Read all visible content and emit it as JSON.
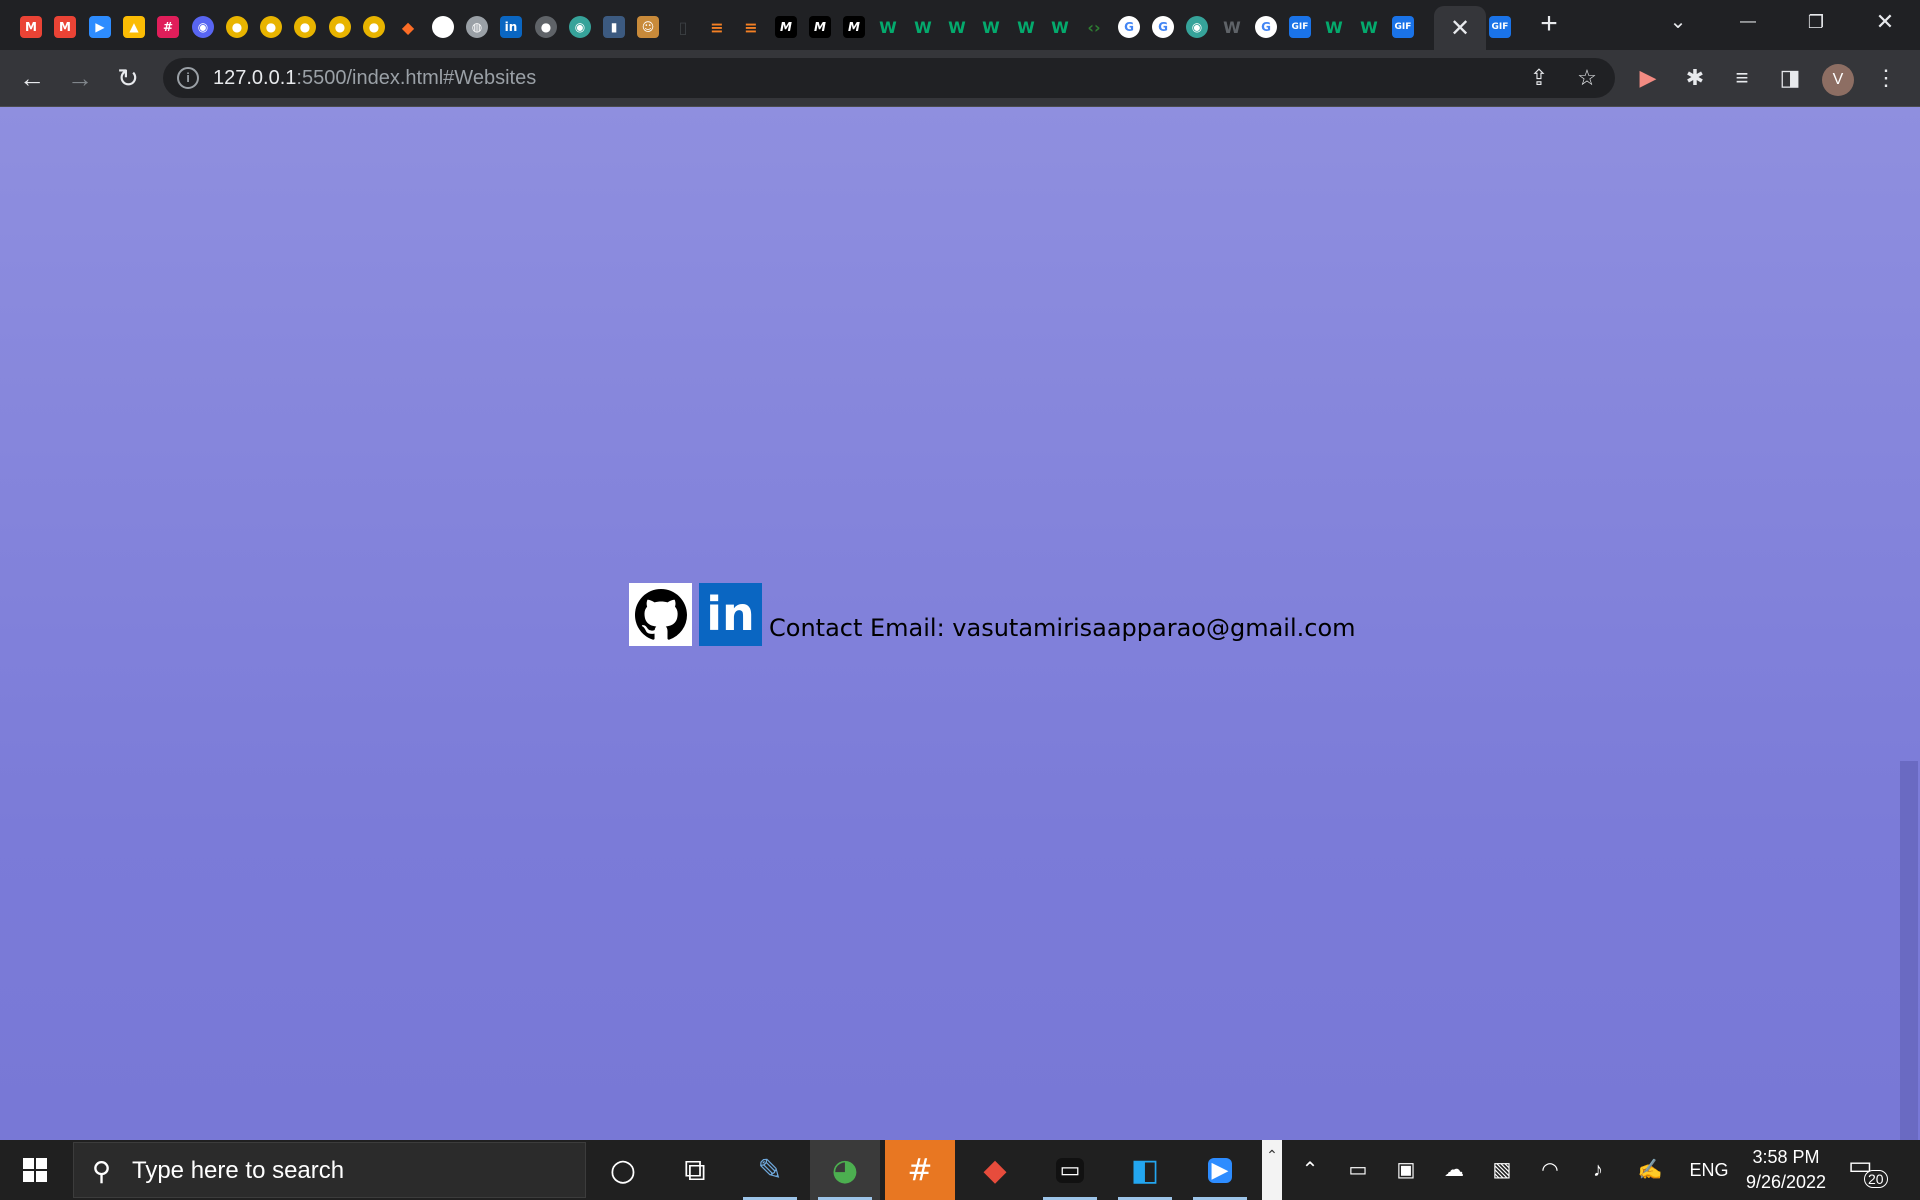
{
  "browser": {
    "tabs": [
      {
        "icon": "gmail-icon",
        "glyph": "M",
        "color": "#ea4335"
      },
      {
        "icon": "gmail-icon",
        "glyph": "M",
        "color": "#ea4335"
      },
      {
        "icon": "zoom-icon",
        "glyph": "▶",
        "color": "#2d8cff"
      },
      {
        "icon": "google-drive-icon",
        "glyph": "▲",
        "color": "#fbbc04"
      },
      {
        "icon": "slack-icon",
        "glyph": "#",
        "color": "#e01e5a"
      },
      {
        "icon": "discord-icon",
        "glyph": "◉",
        "color": "#5865f2"
      },
      {
        "icon": "coin-icon",
        "glyph": "●",
        "color": "#e8b400"
      },
      {
        "icon": "coin-icon",
        "glyph": "●",
        "color": "#e8b400"
      },
      {
        "icon": "coin-icon",
        "glyph": "●",
        "color": "#e8b400"
      },
      {
        "icon": "coin-icon",
        "glyph": "●",
        "color": "#e8b400"
      },
      {
        "icon": "coin-icon",
        "glyph": "●",
        "color": "#e8b400"
      },
      {
        "icon": "gitlab-icon",
        "glyph": "◆",
        "color": "#fc6d26"
      },
      {
        "icon": "github-icon",
        "glyph": "◎",
        "color": "#ffffff"
      },
      {
        "icon": "globe-icon",
        "glyph": "◍",
        "color": "#9aa0a6"
      },
      {
        "icon": "linkedin-icon",
        "glyph": "in",
        "color": "#0a66c2"
      },
      {
        "icon": "lock-badge-icon",
        "glyph": "●",
        "color": "#5f6368"
      },
      {
        "icon": "wikimedia-icon",
        "glyph": "◉",
        "color": "#36a39a"
      },
      {
        "icon": "document-icon",
        "glyph": "▮",
        "color": "#3c5a80"
      },
      {
        "icon": "character-icon",
        "glyph": "☺",
        "color": "#c88a3a"
      },
      {
        "icon": "blank-page-icon",
        "glyph": "▯",
        "color": "#3c4043"
      },
      {
        "icon": "stackoverflow-icon",
        "glyph": "≡",
        "color": "#f48024"
      },
      {
        "icon": "stackoverflow-icon",
        "glyph": "≡",
        "color": "#f48024"
      },
      {
        "icon": "medium-icon",
        "glyph": "M",
        "color": "#000000"
      },
      {
        "icon": "medium-icon",
        "glyph": "M",
        "color": "#000000"
      },
      {
        "icon": "medium-icon",
        "glyph": "M",
        "color": "#000000"
      },
      {
        "icon": "w3schools-icon",
        "glyph": "W",
        "color": "#04aa6d"
      },
      {
        "icon": "w3schools-icon",
        "glyph": "W",
        "color": "#04aa6d"
      },
      {
        "icon": "w3schools-icon",
        "glyph": "W",
        "color": "#04aa6d"
      },
      {
        "icon": "w3schools-icon",
        "glyph": "W",
        "color": "#04aa6d"
      },
      {
        "icon": "w3schools-icon",
        "glyph": "W",
        "color": "#04aa6d"
      },
      {
        "icon": "w3schools-icon",
        "glyph": "W",
        "color": "#04aa6d"
      },
      {
        "icon": "code-icon",
        "glyph": "‹›",
        "color": "#2e7d32"
      },
      {
        "icon": "google-icon",
        "glyph": "G",
        "color": "#4285f4"
      },
      {
        "icon": "google-icon",
        "glyph": "G",
        "color": "#4285f4"
      },
      {
        "icon": "wikimedia-icon",
        "glyph": "◉",
        "color": "#36a39a"
      },
      {
        "icon": "wikipedia-icon",
        "glyph": "W",
        "color": "#5f6368"
      },
      {
        "icon": "google-icon",
        "glyph": "G",
        "color": "#4285f4"
      },
      {
        "icon": "gif-icon",
        "glyph": "GIF",
        "color": "#1a73e8"
      },
      {
        "icon": "w3schools-icon",
        "glyph": "W",
        "color": "#04aa6d"
      },
      {
        "icon": "w3schools-icon",
        "glyph": "W",
        "color": "#04aa6d"
      },
      {
        "icon": "gif-icon",
        "glyph": "GIF",
        "color": "#1a73e8"
      },
      {
        "icon": "loading-icon",
        "glyph": "•",
        "color": "#f28b82"
      }
    ],
    "active_tab": {
      "close_glyph": "✕"
    },
    "after_tab": {
      "icon": "gif-icon",
      "glyph": "GIF",
      "color": "#1a73e8"
    },
    "new_tab_glyph": "+",
    "window_controls": {
      "tab_search": "⌄",
      "minimize": "—",
      "restore": "❐",
      "close": "✕"
    },
    "toolbar": {
      "back": "←",
      "forward": "→",
      "reload": "↻",
      "url_host": "127.0.0.1",
      "url_rest": ":5500/index.html#Websites",
      "share": "⇪",
      "bookmark": "☆",
      "extension_1": "▶",
      "extensions": "✱",
      "media": "≡",
      "side_panel": "◨",
      "menu": "⋮",
      "avatar_letter": "V"
    }
  },
  "page": {
    "contact_text": "Contact Email: vasutamirisaapparao@gmail.com",
    "linkedin_label": "in",
    "colors": {
      "background_top": "#8f8fdf",
      "background_bottom": "#7878d6",
      "linkedin": "#0a66c2"
    }
  },
  "taskbar": {
    "search_placeholder": "Type here to search",
    "apps": [
      {
        "name": "cortana-icon",
        "glyph": "○"
      },
      {
        "name": "task-view-icon",
        "glyph": "⧉"
      },
      {
        "name": "notepad-icon",
        "glyph": "✎"
      },
      {
        "name": "chrome-icon",
        "glyph": "◕"
      },
      {
        "name": "slack-icon",
        "glyph": "#"
      },
      {
        "name": "git-icon",
        "glyph": "◆"
      },
      {
        "name": "terminal-icon",
        "glyph": "▭"
      },
      {
        "name": "vscode-icon",
        "glyph": "◧"
      },
      {
        "name": "zoom-icon",
        "glyph": "▶"
      }
    ],
    "tray": {
      "overflow": "⌃",
      "up": "⌃",
      "network": "▭",
      "meet": "▣",
      "onedrive": "☁",
      "display": "▧",
      "wifi": "◠",
      "volume": "♪",
      "pen": "✍",
      "language": "ENG"
    },
    "time": "3:58 PM",
    "date": "9/26/2022",
    "notification_count": "20"
  }
}
